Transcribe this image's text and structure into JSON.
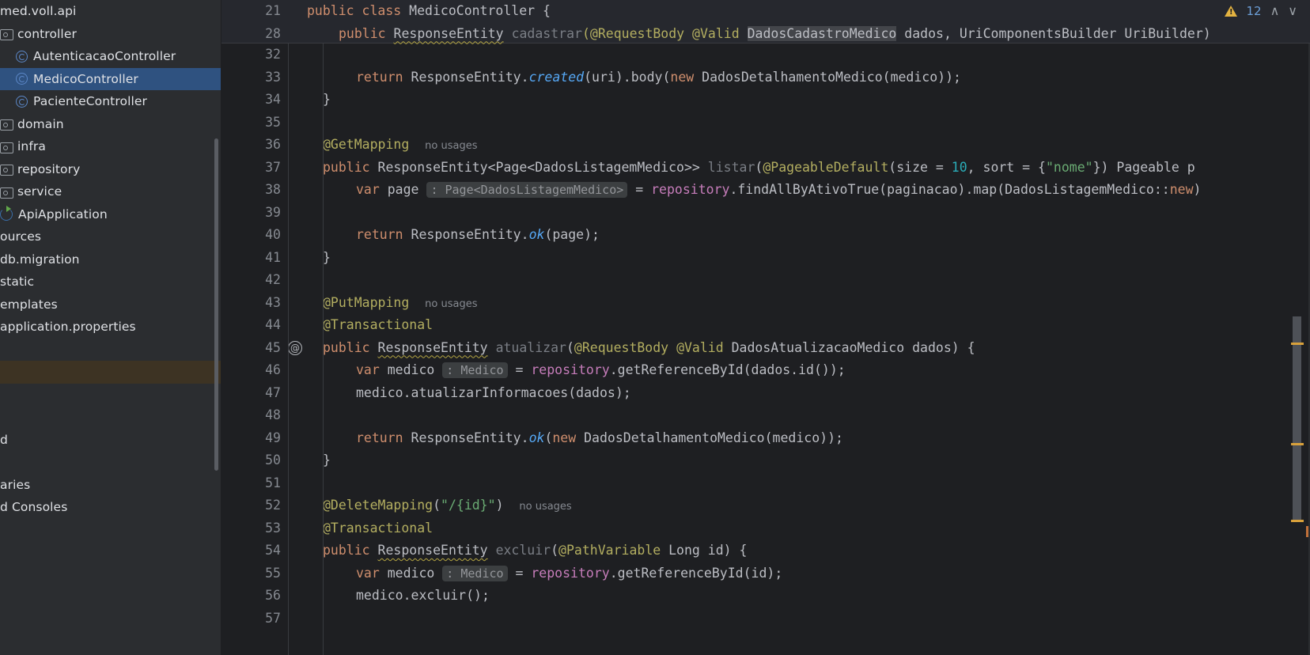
{
  "app": {
    "theme": "dark",
    "accent": "#3574f0"
  },
  "sidebar": {
    "scroll_clipped": true,
    "items": [
      {
        "label": "med.voll.api",
        "icon": "package-icon",
        "indent": 0,
        "state": "normal"
      },
      {
        "label": "controller",
        "icon": "folder-icon",
        "indent": 0,
        "state": "normal"
      },
      {
        "label": "AutenticacaoController",
        "icon": "class-icon",
        "indent": 1,
        "state": "normal"
      },
      {
        "label": "MedicoController",
        "icon": "class-icon",
        "indent": 1,
        "state": "selected"
      },
      {
        "label": "PacienteController",
        "icon": "class-icon",
        "indent": 1,
        "state": "normal"
      },
      {
        "label": "domain",
        "icon": "folder-icon",
        "indent": 0,
        "state": "normal"
      },
      {
        "label": "infra",
        "icon": "folder-icon",
        "indent": 0,
        "state": "normal"
      },
      {
        "label": "repository",
        "icon": "folder-icon",
        "indent": 0,
        "state": "normal"
      },
      {
        "label": "service",
        "icon": "folder-icon",
        "indent": 0,
        "state": "normal"
      },
      {
        "label": "ApiApplication",
        "icon": "spring-app-icon",
        "indent": 0,
        "state": "normal"
      },
      {
        "label": "ources",
        "icon": "none",
        "indent": 0,
        "state": "normal"
      },
      {
        "label": "db.migration",
        "icon": "none",
        "indent": 0,
        "state": "normal"
      },
      {
        "label": "static",
        "icon": "none",
        "indent": 0,
        "state": "normal"
      },
      {
        "label": "emplates",
        "icon": "none",
        "indent": 0,
        "state": "normal"
      },
      {
        "label": "application.properties",
        "icon": "none",
        "indent": 0,
        "state": "normal"
      },
      {
        "label": "",
        "icon": "none",
        "indent": 0,
        "state": "normal"
      },
      {
        "label": "",
        "icon": "none",
        "indent": 0,
        "state": "highlighted"
      },
      {
        "label": "",
        "icon": "none",
        "indent": 0,
        "state": "normal"
      },
      {
        "label": "",
        "icon": "none",
        "indent": 0,
        "state": "normal"
      },
      {
        "label": "d",
        "icon": "none",
        "indent": 0,
        "state": "normal"
      },
      {
        "label": "",
        "icon": "none",
        "indent": 0,
        "state": "normal"
      },
      {
        "label": "aries",
        "icon": "none",
        "indent": 0,
        "state": "normal"
      },
      {
        "label": "d Consoles",
        "icon": "none",
        "indent": 0,
        "state": "normal"
      }
    ]
  },
  "status_bar": {
    "warning_icon": "warning-triangle-icon",
    "warning_count": "12",
    "prev_icon": "chevron-up-icon",
    "next_icon": "chevron-down-icon",
    "prev_glyph": "∧",
    "next_glyph": "∨"
  },
  "editor": {
    "sticky_lines": [
      {
        "n": "21",
        "text": "public class MedicoController {"
      },
      {
        "n": "28",
        "text": "public ResponseEntity cadastrar(@RequestBody @Valid DadosCadastroMedico dados, UriComponentsBuilder UriBuilder)"
      }
    ],
    "lines": [
      {
        "n": "32",
        "text": ""
      },
      {
        "n": "33",
        "text": "        return ResponseEntity.created(uri).body(new DadosDetalhamentoMedico(medico));"
      },
      {
        "n": "34",
        "text": "    }"
      },
      {
        "n": "35",
        "text": ""
      },
      {
        "n": "36",
        "text": "    @GetMapping  no usages"
      },
      {
        "n": "37",
        "text": "    public ResponseEntity<Page<DadosListagemMedico>> listar(@PageableDefault(size = 10, sort = {\"nome\"}) Pageable p"
      },
      {
        "n": "38",
        "text": "        var page : Page<DadosListagemMedico>  = repository.findAllByAtivoTrue(paginacao).map(DadosListagemMedico::new)"
      },
      {
        "n": "39",
        "text": ""
      },
      {
        "n": "40",
        "text": "        return ResponseEntity.ok(page);"
      },
      {
        "n": "41",
        "text": "    }"
      },
      {
        "n": "42",
        "text": ""
      },
      {
        "n": "43",
        "text": "    @PutMapping  no usages"
      },
      {
        "n": "44",
        "text": "    @Transactional"
      },
      {
        "n": "45",
        "text": "    public ResponseEntity atualizar(@RequestBody @Valid DadosAtualizacaoMedico dados) {",
        "gutter": "@"
      },
      {
        "n": "46",
        "text": "        var medico : Medico  = repository.getReferenceById(dados.id());"
      },
      {
        "n": "47",
        "text": "        medico.atualizarInformacoes(dados);"
      },
      {
        "n": "48",
        "text": ""
      },
      {
        "n": "49",
        "text": "        return ResponseEntity.ok(new DadosDetalhamentoMedico(medico));"
      },
      {
        "n": "50",
        "text": "    }"
      },
      {
        "n": "51",
        "text": ""
      },
      {
        "n": "52",
        "text": "    @DeleteMapping(\"/{id}\")  no usages"
      },
      {
        "n": "53",
        "text": "    @Transactional"
      },
      {
        "n": "54",
        "text": "    public ResponseEntity excluir(@PathVariable Long id) {"
      },
      {
        "n": "55",
        "text": "        var medico : Medico  = repository.getReferenceById(id);"
      },
      {
        "n": "56",
        "text": "        medico.excluir();"
      },
      {
        "n": "57",
        "text": ""
      }
    ],
    "inlay_hints": [
      "no usages",
      ": Page<DadosListagemMedico>",
      ": Medico"
    ],
    "selected_identifier": "DadosCadastroMedico"
  },
  "colors": {
    "editor_bg": "#1e1f22",
    "sidebar_bg": "#2b2d30",
    "selection_blue": "#2f5280",
    "keyword": "#cf8e6d",
    "annotation": "#b3ae60",
    "string": "#6aab73",
    "number": "#2aacb8",
    "method": "#56a8f5",
    "field": "#c77dbb",
    "text": "#bcbec4",
    "warning": "#e3b341"
  }
}
